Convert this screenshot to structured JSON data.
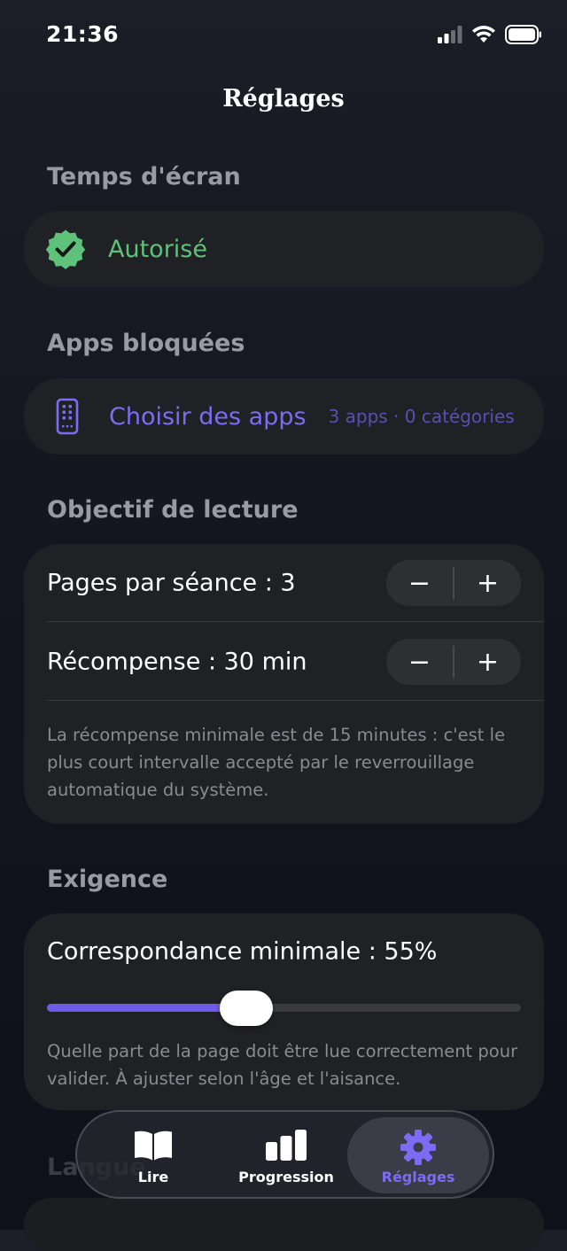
{
  "status_bar": {
    "time": "21:36"
  },
  "page": {
    "title": "Réglages"
  },
  "screen_time": {
    "header": "Temps d'écran",
    "status": "Autorisé",
    "status_color": "#5fc27a"
  },
  "blocked_apps": {
    "header": "Apps bloquées",
    "action": "Choisir des apps",
    "summary": "3 apps · 0 catégories"
  },
  "reading_goal": {
    "header": "Objectif de lecture",
    "pages_label": "Pages par séance : 3",
    "reward_label": "Récompense : 30 min",
    "minus": "−",
    "plus": "+",
    "note": "La récompense minimale est de 15 minutes : c'est le plus court intervalle accepté par le reverrouillage automatique du système."
  },
  "requirement": {
    "header": "Exigence",
    "label": "Correspondance minimale : 55%",
    "slider_value": 0.42,
    "note": "Quelle part de la page doit être lue correctement pour valider. À ajuster selon l'âge et l'aisance."
  },
  "behind_section": {
    "header": "Langue"
  },
  "tab_bar": {
    "tabs": [
      {
        "label": "Lire",
        "icon": "book-icon",
        "active": false
      },
      {
        "label": "Progression",
        "icon": "bar-chart-icon",
        "active": false
      },
      {
        "label": "Réglages",
        "icon": "gear-icon",
        "active": true
      }
    ]
  },
  "colors": {
    "accent": "#7c6cf5",
    "success": "#5fc27a"
  }
}
